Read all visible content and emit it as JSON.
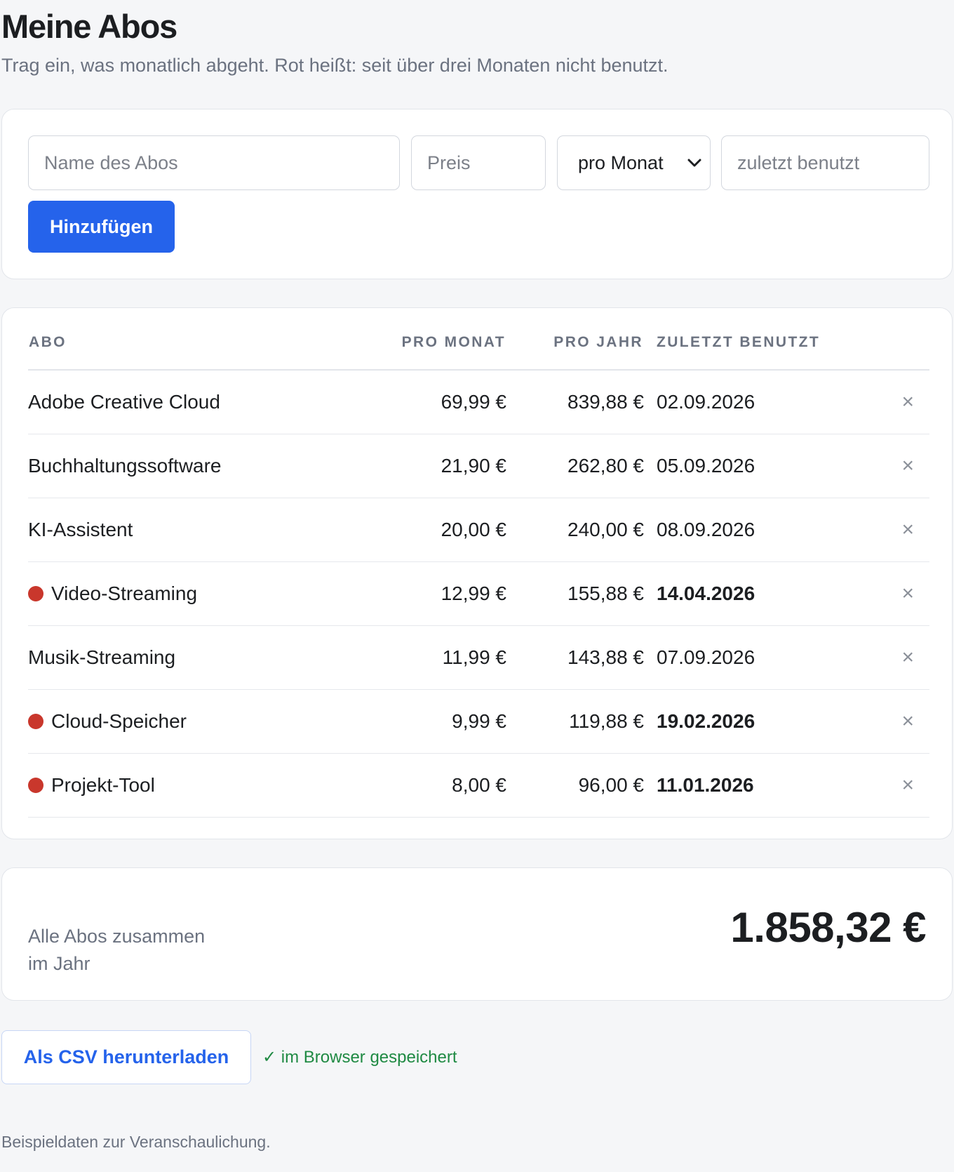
{
  "header": {
    "title": "Meine Abos",
    "subtitle": "Trag ein, was monatlich abgeht. Rot heißt: seit über drei Monaten nicht benutzt."
  },
  "form": {
    "name_placeholder": "Name des Abos",
    "price_placeholder": "Preis",
    "period_value": "pro Monat",
    "last_used_placeholder": "zuletzt benutzt",
    "add_label": "Hinzufügen"
  },
  "table": {
    "headers": [
      "Abo",
      "Pro Monat",
      "Pro Jahr",
      "Zuletzt benutzt"
    ],
    "rows": [
      {
        "name": "Adobe Creative Cloud",
        "monthly": "69,99 €",
        "yearly": "839,88 €",
        "last_used": "02.09.2026",
        "stale": false
      },
      {
        "name": "Buchhaltungssoftware",
        "monthly": "21,90 €",
        "yearly": "262,80 €",
        "last_used": "05.09.2026",
        "stale": false
      },
      {
        "name": "KI-Assistent",
        "monthly": "20,00 €",
        "yearly": "240,00 €",
        "last_used": "08.09.2026",
        "stale": false
      },
      {
        "name": "Video-Streaming",
        "monthly": "12,99 €",
        "yearly": "155,88 €",
        "last_used": "14.04.2026",
        "stale": true
      },
      {
        "name": "Musik-Streaming",
        "monthly": "11,99 €",
        "yearly": "143,88 €",
        "last_used": "07.09.2026",
        "stale": false
      },
      {
        "name": "Cloud-Speicher",
        "monthly": "9,99 €",
        "yearly": "119,88 €",
        "last_used": "19.02.2026",
        "stale": true
      },
      {
        "name": "Projekt-Tool",
        "monthly": "8,00 €",
        "yearly": "96,00 €",
        "last_used": "11.01.2026",
        "stale": true
      }
    ],
    "delete_symbol": "×"
  },
  "total": {
    "label_line1": "Alle Abos zusammen",
    "label_line2": "im Jahr",
    "value": "1.858,32 €"
  },
  "actions": {
    "csv_label": "Als CSV herunterladen",
    "saved_status": "✓ im Browser gespeichert"
  },
  "footnote": "Beispieldaten zur Veranschaulichung.",
  "colors": {
    "accent": "#2563eb",
    "stale": "#c9372c",
    "success": "#1f8a43"
  }
}
